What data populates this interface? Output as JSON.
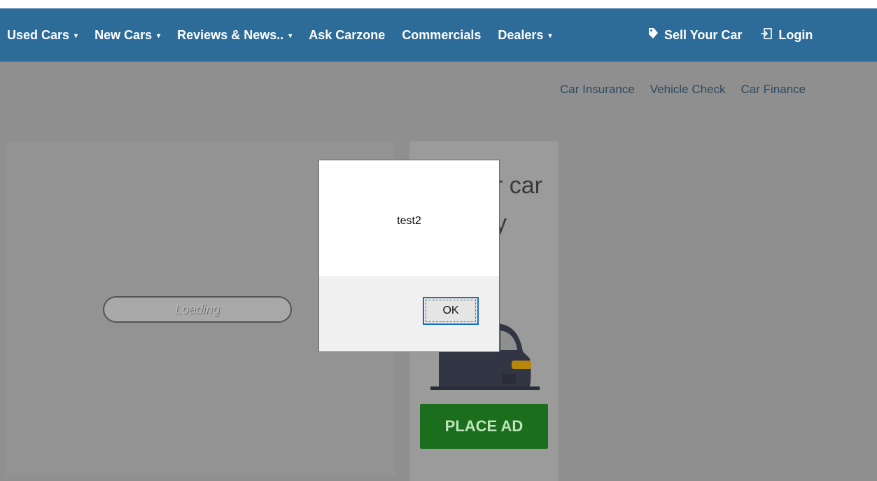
{
  "nav": {
    "items": [
      {
        "label": "Used Cars",
        "dropdown": true
      },
      {
        "label": "New Cars",
        "dropdown": true
      },
      {
        "label": "Reviews & News..",
        "dropdown": true
      },
      {
        "label": "Ask Carzone",
        "dropdown": false
      },
      {
        "label": "Commercials",
        "dropdown": false
      },
      {
        "label": "Dealers",
        "dropdown": true
      }
    ],
    "caret": "▾",
    "sell_label": "Sell Your Car",
    "sell_icon": "tag-icon",
    "login_label": "Login",
    "login_icon": "login-icon"
  },
  "subnav": [
    "Car Insurance",
    "Vehicle Check",
    "Car Finance"
  ],
  "main": {
    "loading_text": "Loading"
  },
  "sell_panel": {
    "title": "r car\ny",
    "place_ad_label": "PLACE AD"
  },
  "dialog": {
    "message": "test2",
    "ok_label": "OK"
  },
  "colors": {
    "nav_bg": "#2d6b98",
    "overlay_bg": "#8f8f8f",
    "place_ad_bg": "#1b6e1b",
    "focus_border": "#1570c9"
  }
}
